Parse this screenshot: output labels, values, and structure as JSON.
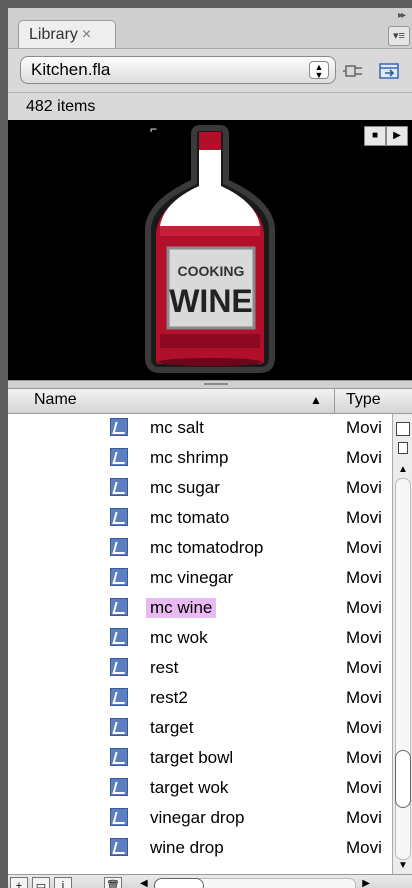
{
  "tab": {
    "label": "Library",
    "close": "×"
  },
  "file": {
    "selected": "Kitchen.fla"
  },
  "item_count": "482 items",
  "preview": {
    "label_top": "COOKING",
    "label_bottom": "WINE",
    "stop": "■",
    "play": "▶"
  },
  "columns": {
    "name": "Name",
    "type": "Type",
    "sort": "▲"
  },
  "items": [
    {
      "name": "mc salt",
      "type": "Movi"
    },
    {
      "name": "mc shrimp",
      "type": "Movi"
    },
    {
      "name": "mc sugar",
      "type": "Movi"
    },
    {
      "name": "mc tomato",
      "type": "Movi"
    },
    {
      "name": "mc tomatodrop",
      "type": "Movi"
    },
    {
      "name": "mc vinegar",
      "type": "Movi"
    },
    {
      "name": "mc wine",
      "type": "Movi",
      "selected": true
    },
    {
      "name": "mc wok",
      "type": "Movi"
    },
    {
      "name": "rest",
      "type": "Movi"
    },
    {
      "name": "rest2",
      "type": "Movi"
    },
    {
      "name": "target",
      "type": "Movi"
    },
    {
      "name": "target bowl",
      "type": "Movi"
    },
    {
      "name": "target wok",
      "type": "Movi"
    },
    {
      "name": "vinegar drop",
      "type": "Movi"
    },
    {
      "name": "wine drop",
      "type": "Movi"
    }
  ],
  "colors": {
    "selection": "#e9b9f2",
    "symbol_icon": "#5b7fc0",
    "wine": "#b0102a"
  }
}
